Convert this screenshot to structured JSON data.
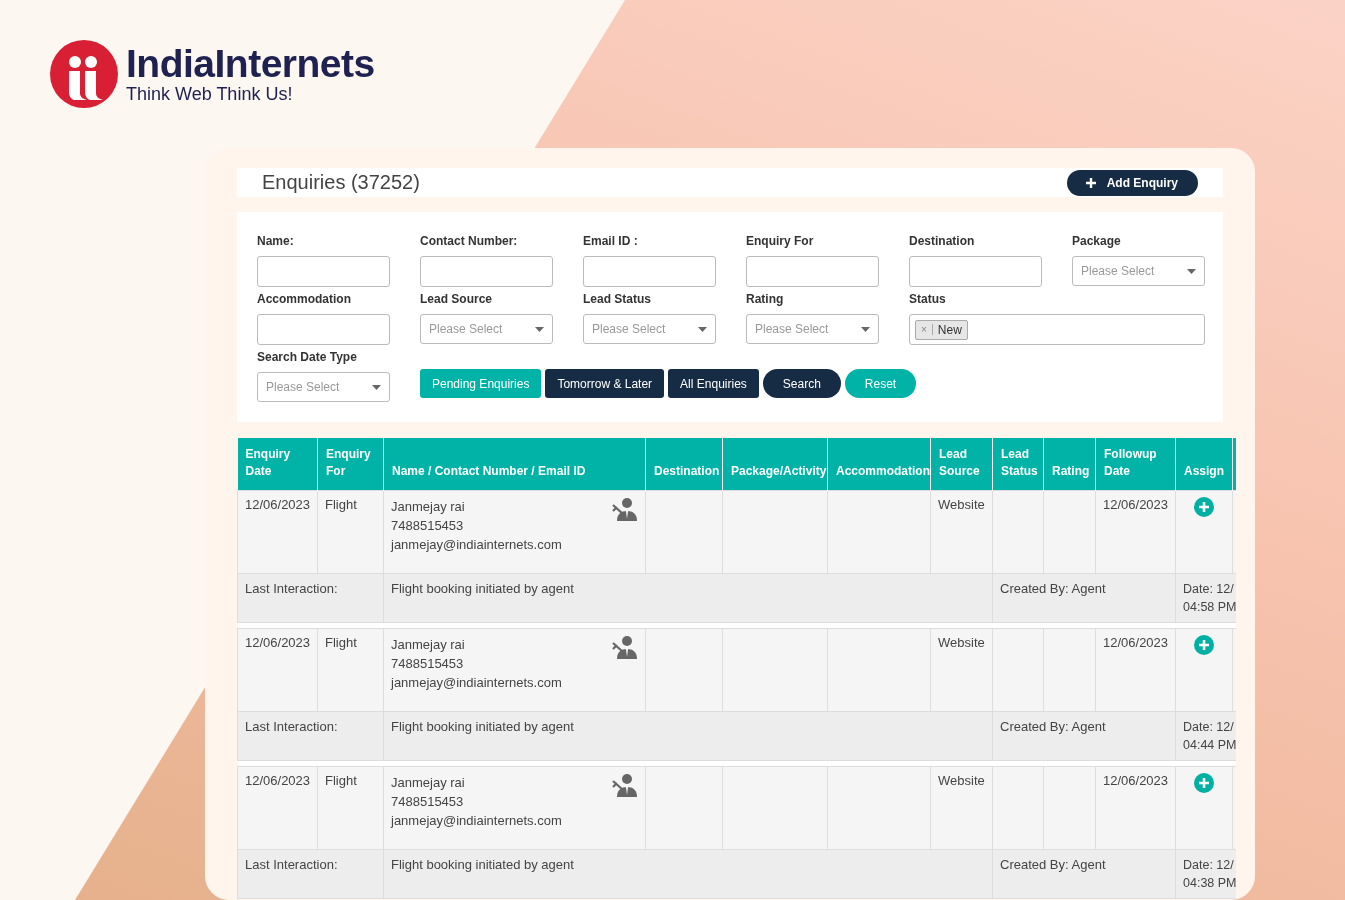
{
  "brand": {
    "name": "IndiaInternets",
    "tagline": "Think Web Think Us!"
  },
  "page": {
    "title": "Enquiries (37252)",
    "add_button": "Add Enquiry"
  },
  "filters": [
    {
      "label": "Name:",
      "kind": "text"
    },
    {
      "label": "Contact Number:",
      "kind": "text"
    },
    {
      "label": "Email ID :",
      "kind": "text"
    },
    {
      "label": "Enquiry For",
      "kind": "text"
    },
    {
      "label": "Destination",
      "kind": "text"
    },
    {
      "label": "Package",
      "kind": "select",
      "placeholder": "Please Select"
    },
    {
      "label": "Accommodation",
      "kind": "text"
    },
    {
      "label": "Lead Source",
      "kind": "select",
      "placeholder": "Please Select"
    },
    {
      "label": "Lead Status",
      "kind": "select",
      "placeholder": "Please Select"
    },
    {
      "label": "Rating",
      "kind": "select",
      "placeholder": "Please Select"
    },
    {
      "label": "Status",
      "kind": "tags",
      "tags": [
        {
          "remove": "×",
          "text": "New"
        }
      ]
    },
    {
      "label": "Search Date Type",
      "kind": "select",
      "placeholder": "Please Select"
    }
  ],
  "actions": [
    {
      "label": "Pending Enquiries",
      "kind": "primary",
      "pill": false
    },
    {
      "label": "Tomorrow & Later",
      "kind": "secondary",
      "pill": false
    },
    {
      "label": "All Enquiries",
      "kind": "secondary",
      "pill": false
    },
    {
      "label": "Search",
      "kind": "secondary",
      "pill": true
    },
    {
      "label": "Reset",
      "kind": "primary",
      "pill": true
    }
  ],
  "table": {
    "columns": [
      "Enquiry Date",
      "Enquiry For",
      "Name / Contact Number / Email ID",
      "Destination",
      "Package/Activity",
      "Accommodation",
      "Lead Source",
      "Lead Status",
      "Rating",
      "Followup Date",
      "Assign"
    ],
    "rows": [
      {
        "date": "12/06/2023",
        "for": "Flight",
        "name": "Janmejay rai",
        "phone": "7488515453",
        "email": "janmejay@indiainternets.com",
        "source": "Website",
        "followup": "12/06/2023",
        "interaction_label": "Last Interaction:",
        "interaction": "Flight booking initiated by agent",
        "created_by": "Created By: Agent",
        "date_lines": [
          "Date: 12/",
          "04:58 PM"
        ]
      },
      {
        "date": "12/06/2023",
        "for": "Flight",
        "name": "Janmejay rai",
        "phone": "7488515453",
        "email": "janmejay@indiainternets.com",
        "source": "Website",
        "followup": "12/06/2023",
        "interaction_label": "Last Interaction:",
        "interaction": "Flight booking initiated by agent",
        "created_by": "Created By: Agent",
        "date_lines": [
          "Date: 12/",
          "04:44 PM"
        ]
      },
      {
        "date": "12/06/2023",
        "for": "Flight",
        "name": "Janmejay rai",
        "phone": "7488515453",
        "email": "janmejay@indiainternets.com",
        "source": "Website",
        "followup": "12/06/2023",
        "interaction_label": "Last Interaction:",
        "interaction": "Flight booking initiated by agent",
        "created_by": "Created By: Agent",
        "date_lines": [
          "Date: 12/",
          "04:38 PM"
        ]
      }
    ]
  }
}
